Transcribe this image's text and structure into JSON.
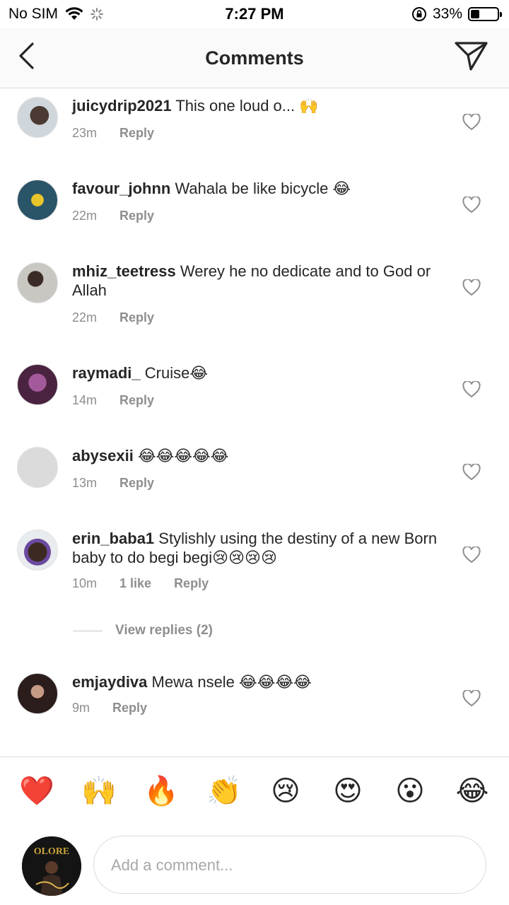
{
  "status_bar": {
    "carrier": "No SIM",
    "time": "7:27 PM",
    "battery_percent": "33%",
    "battery_level": 0.33
  },
  "header": {
    "title": "Comments",
    "icons": [
      "back-arrow-icon",
      "direct-message-icon"
    ]
  },
  "comments": [
    {
      "username": "juicydrip2021",
      "text": "This one loud o... 🙌",
      "time": "23m",
      "likes": "",
      "reply": "Reply"
    },
    {
      "username": "favour_johnn",
      "text": "Wahala be like bicycle 😂",
      "time": "22m",
      "likes": "",
      "reply": "Reply"
    },
    {
      "username": "mhiz_teetress",
      "text": "Werey he no dedicate and to God or Allah",
      "time": "22m",
      "likes": "",
      "reply": "Reply"
    },
    {
      "username": "raymadi_",
      "text": "Cruise😂",
      "time": "14m",
      "likes": "",
      "reply": "Reply"
    },
    {
      "username": "abysexii",
      "text": "😂😂😂😂😂",
      "time": "13m",
      "likes": "",
      "reply": "Reply"
    },
    {
      "username": "erin_baba1",
      "text": "Stylishly using the destiny of a new Born baby to do begi begi😢😢😢😢",
      "time": "10m",
      "likes": "1 like",
      "reply": "Reply"
    },
    {
      "username": "emjaydiva",
      "text": "Mewa nsele 😂😂😂😂",
      "time": "9m",
      "likes": "",
      "reply": "Reply"
    }
  ],
  "view_replies": "View replies (2)",
  "quick_reactions": [
    "❤️",
    "🙌",
    "🔥",
    "👏",
    "😢",
    "😍",
    "😮",
    "😂"
  ],
  "composer": {
    "placeholder": "Add a comment...",
    "avatar_text": "OLORE"
  },
  "colors": {
    "text": "#262626",
    "secondary_text": "#8e8e8e",
    "divider": "#dbdbdb",
    "header_bg": "#fafafa"
  }
}
